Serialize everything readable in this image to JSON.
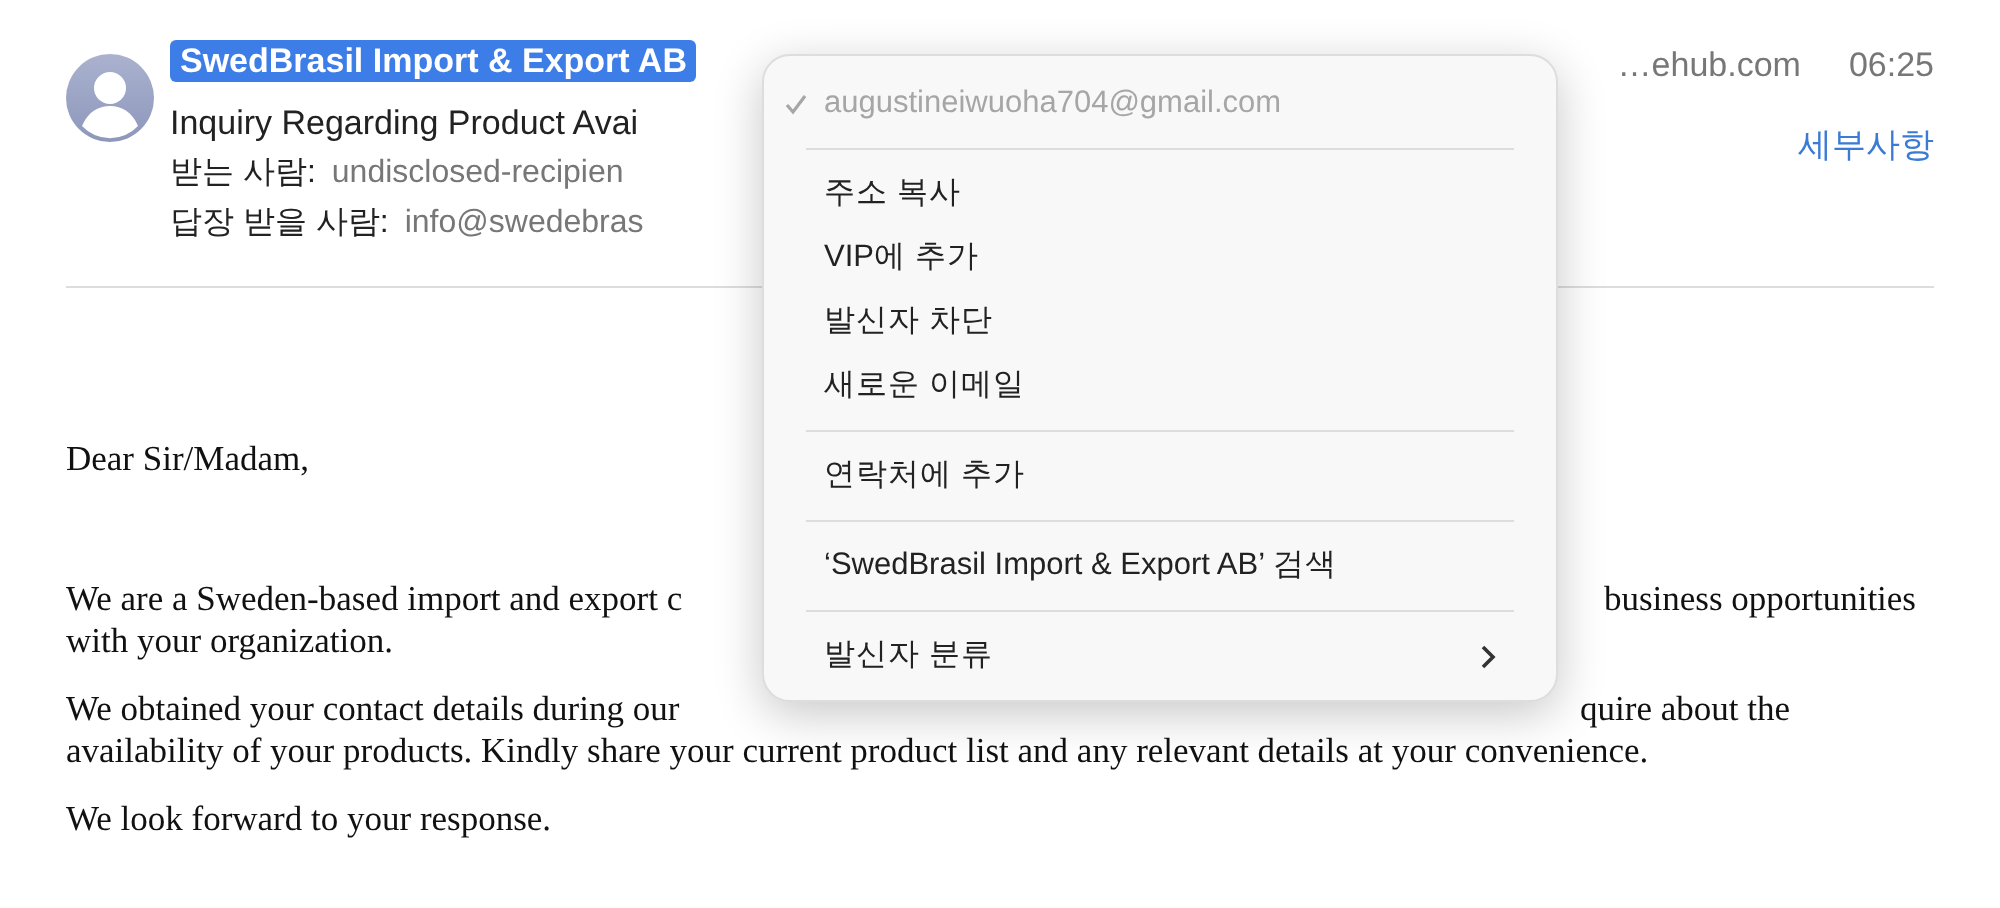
{
  "message_header": {
    "sender": {
      "name": "SwedBrasil Import & Export AB",
      "selected": true
    },
    "subject": "Inquiry Regarding Product Avai",
    "to": {
      "label": "받는 사람:",
      "value": "undisclosed-recipien"
    },
    "reply_to": {
      "label": "답장 받을 사람:",
      "value": "info@swedebras"
    },
    "address_fragment": "…ehub.com",
    "time": "06:25",
    "details_link": "세부사항"
  },
  "body": {
    "greeting": "Dear Sir/Madam,",
    "paragraphs": [
      {
        "lines": [
          [
            "We are a Sweden-based import and export c",
            "business opportunities"
          ],
          [
            "with your organization."
          ]
        ]
      },
      {
        "lines": [
          [
            "We obtained your contact details during our",
            "quire about the"
          ],
          [
            "availability of your products. Kindly share your current product list and any relevant details at your convenience."
          ]
        ]
      },
      {
        "lines": [
          [
            "We look forward to your response."
          ]
        ]
      }
    ]
  },
  "context_menu": {
    "items": [
      {
        "kind": "address",
        "label": "augustineiwuoha704@gmail.com",
        "checked": true
      },
      {
        "kind": "separator"
      },
      {
        "kind": "item",
        "label": "주소 복사"
      },
      {
        "kind": "item",
        "label": "VIP에 추가"
      },
      {
        "kind": "item",
        "label": "발신자 차단"
      },
      {
        "kind": "item",
        "label": "새로운 이메일"
      },
      {
        "kind": "separator"
      },
      {
        "kind": "item",
        "label": "연락처에 추가"
      },
      {
        "kind": "separator"
      },
      {
        "kind": "item",
        "label": "‘SwedBrasil Import & Export AB’ 검색"
      },
      {
        "kind": "separator"
      },
      {
        "kind": "submenu",
        "label": "발신자 분류"
      }
    ]
  }
}
